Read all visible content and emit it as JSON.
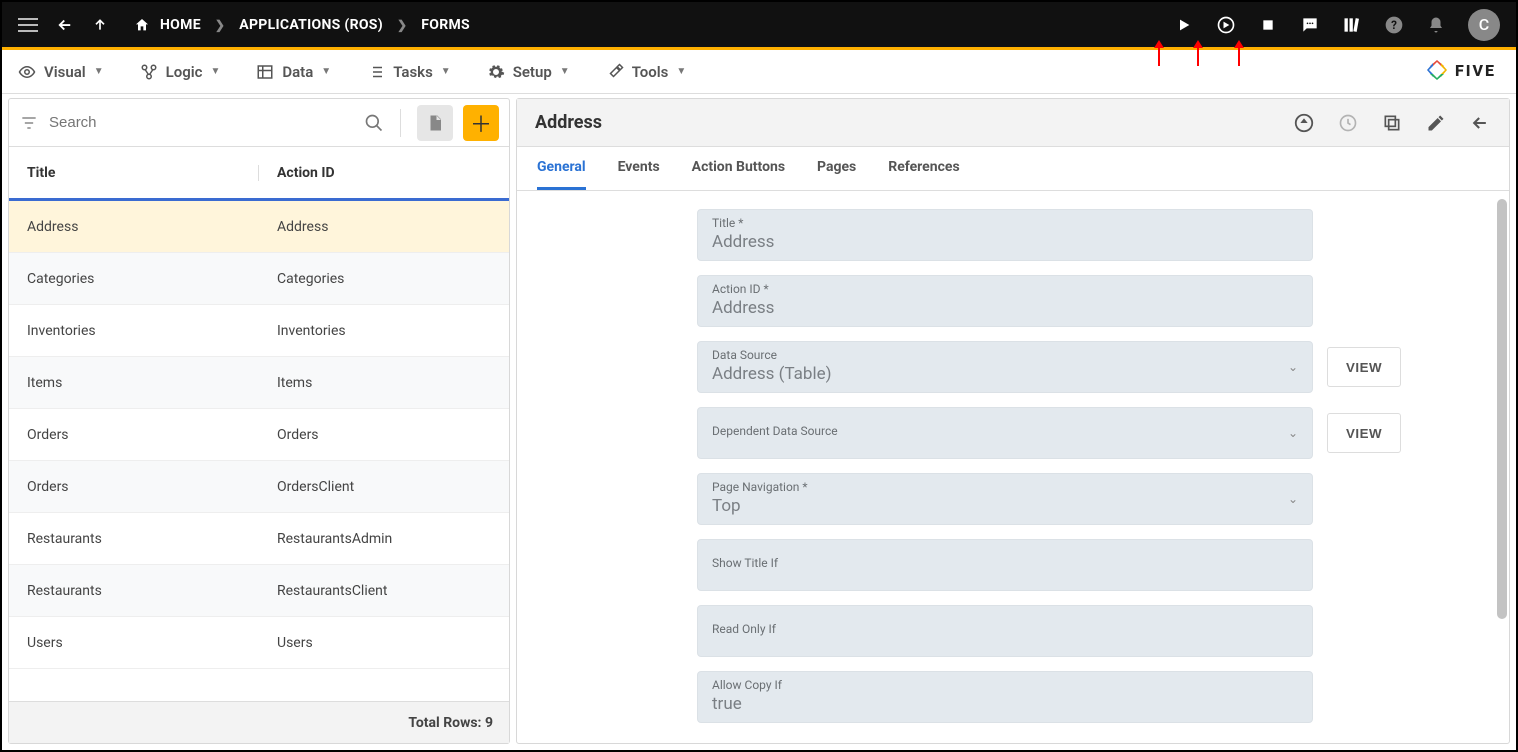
{
  "breadcrumb": {
    "home": "HOME",
    "level1": "APPLICATIONS (ROS)",
    "level2": "FORMS"
  },
  "avatar_letter": "C",
  "brand": "FIVE",
  "menubar": {
    "visual": "Visual",
    "logic": "Logic",
    "data": "Data",
    "tasks": "Tasks",
    "setup": "Setup",
    "tools": "Tools"
  },
  "left_panel": {
    "search_placeholder": "Search",
    "columns": {
      "title": "Title",
      "action_id": "Action ID"
    },
    "rows": [
      {
        "title": "Address",
        "action_id": "Address"
      },
      {
        "title": "Categories",
        "action_id": "Categories"
      },
      {
        "title": "Inventories",
        "action_id": "Inventories"
      },
      {
        "title": "Items",
        "action_id": "Items"
      },
      {
        "title": "Orders",
        "action_id": "Orders"
      },
      {
        "title": "Orders",
        "action_id": "OrdersClient"
      },
      {
        "title": "Restaurants",
        "action_id": "RestaurantsAdmin"
      },
      {
        "title": "Restaurants",
        "action_id": "RestaurantsClient"
      },
      {
        "title": "Users",
        "action_id": "Users"
      }
    ],
    "footer": "Total Rows: 9"
  },
  "right_panel": {
    "title": "Address",
    "tabs": {
      "general": "General",
      "events": "Events",
      "action_buttons": "Action Buttons",
      "pages": "Pages",
      "references": "References"
    },
    "form": {
      "title_label": "Title *",
      "title_value": "Address",
      "action_id_label": "Action ID *",
      "action_id_value": "Address",
      "data_source_label": "Data Source",
      "data_source_value": "Address (Table)",
      "dep_ds_label": "Dependent Data Source",
      "dep_ds_value": "",
      "page_nav_label": "Page Navigation *",
      "page_nav_value": "Top",
      "show_title_if_label": "Show Title If",
      "show_title_if_value": "",
      "read_only_if_label": "Read Only If",
      "read_only_if_value": "",
      "allow_copy_if_label": "Allow Copy If",
      "allow_copy_if_value": "true",
      "view_btn": "VIEW"
    }
  }
}
